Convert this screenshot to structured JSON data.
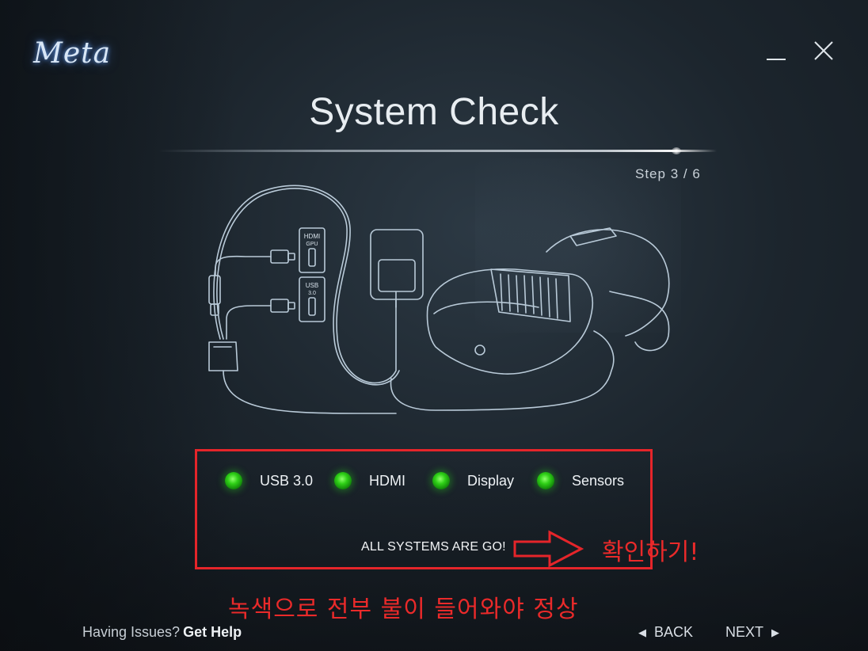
{
  "app": {
    "logo_text": "Meta",
    "window_controls": {
      "minimize": "minimize-icon",
      "close": "close-icon"
    }
  },
  "header": {
    "title": "System Check",
    "step": "Step  3 / 6"
  },
  "illustration": {
    "ports": [
      {
        "label_line1": "HDMI",
        "label_line2": "GPU"
      },
      {
        "label_line1": "USB",
        "label_line2": "3.0"
      }
    ]
  },
  "status": {
    "items": [
      {
        "label": "USB 3.0",
        "state": "ok",
        "color": "#2fd017"
      },
      {
        "label": "HDMI",
        "state": "ok",
        "color": "#2fd017"
      },
      {
        "label": "Display",
        "state": "ok",
        "color": "#2fd017"
      },
      {
        "label": "Sensors",
        "state": "ok",
        "color": "#2fd017"
      }
    ],
    "summary": "ALL SYSTEMS ARE GO!"
  },
  "annotations": {
    "confirm_note": "확인하기!",
    "green_note": "녹색으로 전부 불이 들어와야 정상",
    "highlight_color": "#e5252a"
  },
  "footer": {
    "help_prefix": "Having Issues?",
    "help_link": "Get Help",
    "back_label": "BACK",
    "next_label": "NEXT"
  }
}
